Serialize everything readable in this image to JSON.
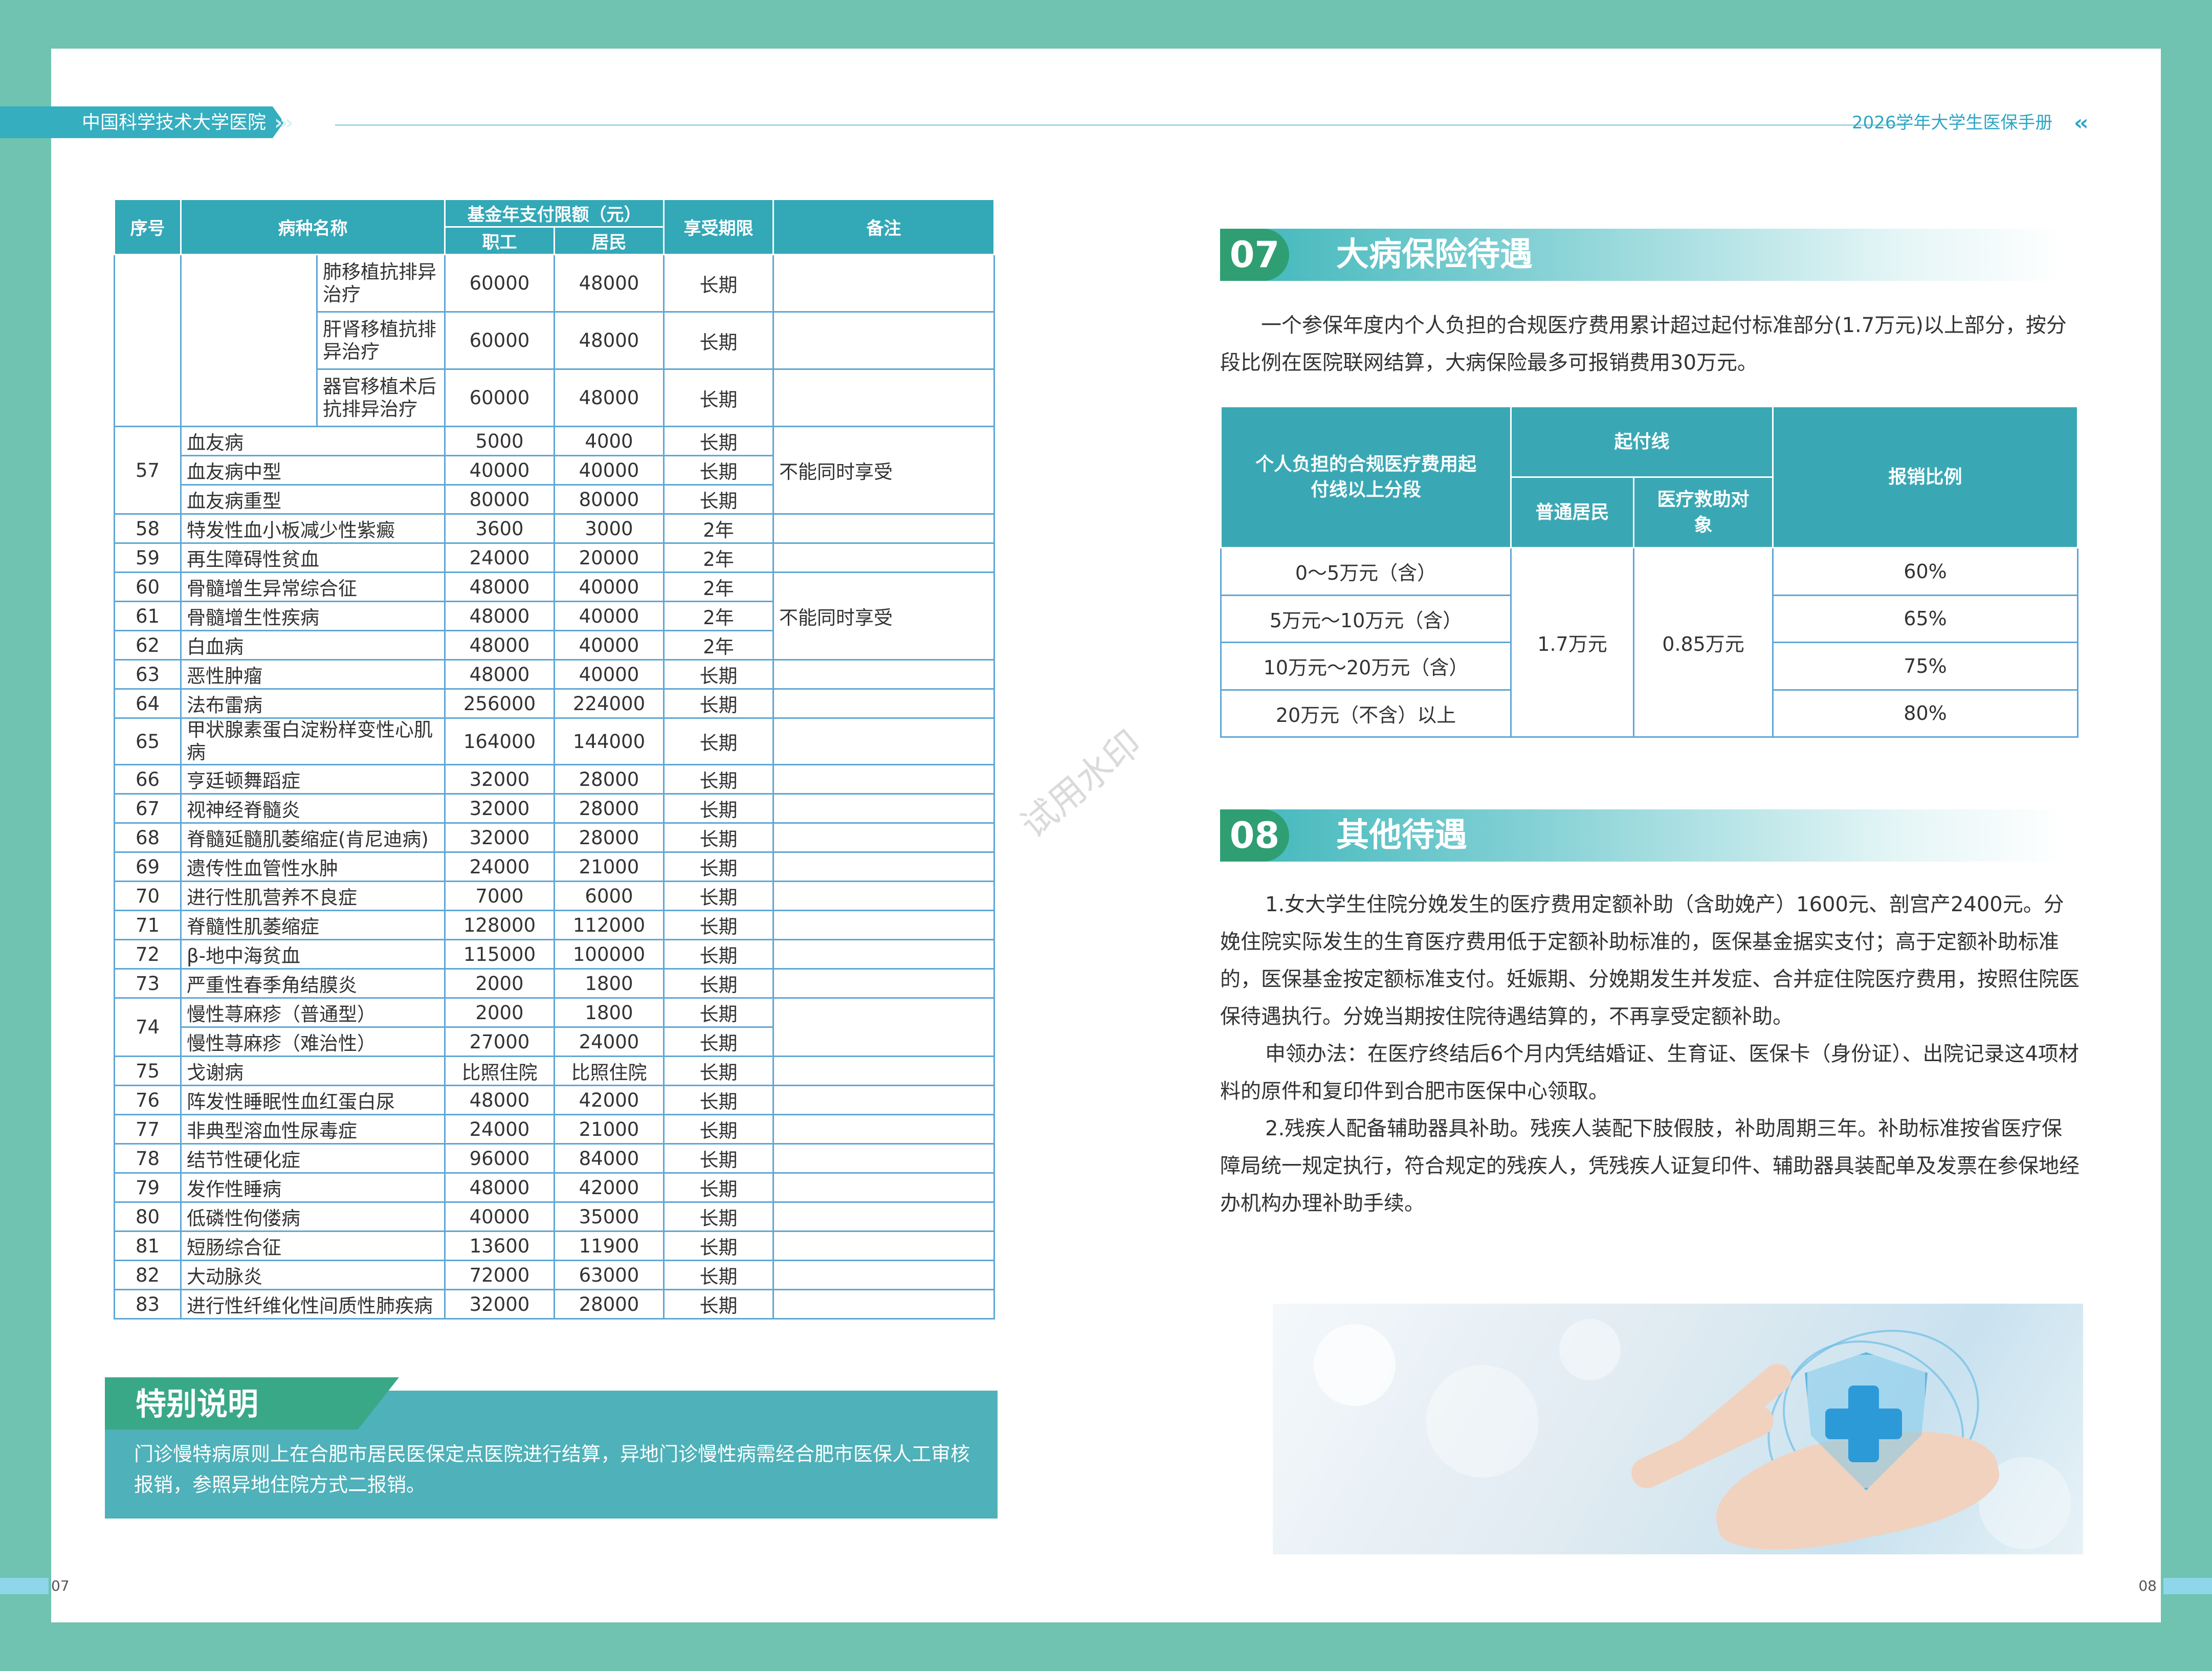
{
  "header": {
    "left_title": "中国科学技术大学医院",
    "left_chevrons": "›››",
    "right_title": "2026学年大学生医保手册",
    "right_chevrons": "‹‹"
  },
  "left_table": {
    "headers": {
      "seq": "序号",
      "name": "病种名称",
      "limit": "基金年支付限额（元）",
      "worker": "职工",
      "resident": "居民",
      "period": "享受期限",
      "remark": "备注"
    },
    "top_rows": [
      {
        "sub": "肺移植抗排异治疗",
        "worker": "60000",
        "resident": "48000",
        "period": "长期"
      },
      {
        "sub": "肝肾移植抗排异治疗",
        "worker": "60000",
        "resident": "48000",
        "period": "长期"
      },
      {
        "sub": "器官移植术后抗排异治疗",
        "worker": "60000",
        "resident": "48000",
        "period": "长期"
      }
    ],
    "g57": {
      "seq": "57",
      "remark": "不能同时享受",
      "rows": [
        {
          "name": "血友病",
          "worker": "5000",
          "resident": "4000",
          "period": "长期"
        },
        {
          "name": "血友病中型",
          "worker": "40000",
          "resident": "40000",
          "period": "长期"
        },
        {
          "name": "血友病重型",
          "worker": "80000",
          "resident": "80000",
          "period": "长期"
        }
      ]
    },
    "r58": {
      "seq": "58",
      "name": "特发性血小板减少性紫癜",
      "worker": "3600",
      "resident": "3000",
      "period": "2年"
    },
    "r59": {
      "seq": "59",
      "name": "再生障碍性贫血",
      "worker": "24000",
      "resident": "20000",
      "period": "2年"
    },
    "r60": {
      "seq": "60",
      "name": "骨髓增生异常综合征",
      "worker": "48000",
      "resident": "40000",
      "period": "2年"
    },
    "r61": {
      "seq": "61",
      "name": "骨髓增生性疾病",
      "worker": "48000",
      "resident": "40000",
      "period": "2年",
      "remark": "不能同时享受"
    },
    "r62": {
      "seq": "62",
      "name": "白血病",
      "worker": "48000",
      "resident": "40000",
      "period": "2年"
    },
    "r63": {
      "seq": "63",
      "name": "恶性肿瘤",
      "worker": "48000",
      "resident": "40000",
      "period": "长期"
    },
    "r64": {
      "seq": "64",
      "name": "法布雷病",
      "worker": "256000",
      "resident": "224000",
      "period": "长期"
    },
    "r65": {
      "seq": "65",
      "name": "甲状腺素蛋白淀粉样变性心肌病",
      "worker": "164000",
      "resident": "144000",
      "period": "长期"
    },
    "r66": {
      "seq": "66",
      "name": "亨廷顿舞蹈症",
      "worker": "32000",
      "resident": "28000",
      "period": "长期"
    },
    "r67": {
      "seq": "67",
      "name": "视神经脊髓炎",
      "worker": "32000",
      "resident": "28000",
      "period": "长期"
    },
    "r68": {
      "seq": "68",
      "name": "脊髓延髓肌萎缩症(肯尼迪病)",
      "worker": "32000",
      "resident": "28000",
      "period": "长期"
    },
    "r69": {
      "seq": "69",
      "name": "遗传性血管性水肿",
      "worker": "24000",
      "resident": "21000",
      "period": "长期"
    },
    "r70": {
      "seq": "70",
      "name": "进行性肌营养不良症",
      "worker": "7000",
      "resident": "6000",
      "period": "长期"
    },
    "r71": {
      "seq": "71",
      "name": "脊髓性肌萎缩症",
      "worker": "128000",
      "resident": "112000",
      "period": "长期"
    },
    "r72": {
      "seq": "72",
      "name": "β-地中海贫血",
      "worker": "115000",
      "resident": "100000",
      "period": "长期"
    },
    "r73": {
      "seq": "73",
      "name": "严重性春季角结膜炎",
      "worker": "2000",
      "resident": "1800",
      "period": "长期"
    },
    "g74": {
      "seq": "74",
      "rows": [
        {
          "name": "慢性荨麻疹（普通型）",
          "worker": "2000",
          "resident": "1800",
          "period": "长期"
        },
        {
          "name": "慢性荨麻疹（难治性）",
          "worker": "27000",
          "resident": "24000",
          "period": "长期"
        }
      ]
    },
    "r75": {
      "seq": "75",
      "name": "戈谢病",
      "worker": "比照住院",
      "resident": "比照住院",
      "period": "长期"
    },
    "r76": {
      "seq": "76",
      "name": "阵发性睡眠性血红蛋白尿",
      "worker": "48000",
      "resident": "42000",
      "period": "长期"
    },
    "r77": {
      "seq": "77",
      "name": "非典型溶血性尿毒症",
      "worker": "24000",
      "resident": "21000",
      "period": "长期"
    },
    "r78": {
      "seq": "78",
      "name": "结节性硬化症",
      "worker": "96000",
      "resident": "84000",
      "period": "长期"
    },
    "r79": {
      "seq": "79",
      "name": "发作性睡病",
      "worker": "48000",
      "resident": "42000",
      "period": "长期"
    },
    "r80": {
      "seq": "80",
      "name": "低磷性佝偻病",
      "worker": "40000",
      "resident": "35000",
      "period": "长期"
    },
    "r81": {
      "seq": "81",
      "name": "短肠综合征",
      "worker": "13600",
      "resident": "11900",
      "period": "长期"
    },
    "r82": {
      "seq": "82",
      "name": "大动脉炎",
      "worker": "72000",
      "resident": "63000",
      "period": "长期"
    },
    "r83": {
      "seq": "83",
      "name": "进行性纤维化性间质性肺疾病",
      "worker": "32000",
      "resident": "28000",
      "period": "长期"
    }
  },
  "special_note": {
    "title": "特别说明",
    "text": "门诊慢特病原则上在合肥市居民医保定点医院进行结算，异地门诊慢性病需经合肥市医保人工审核报销，参照异地住院方式二报销。"
  },
  "section07": {
    "num": "07",
    "title": "大病保险待遇",
    "intro": "一个参保年度内个人负担的合规医疗费用累计超过起付标准部分(1.7万元)以上部分，按分段比例在医院联网结算，大病保险最多可报销费用30万元。",
    "table": {
      "h_segment": "个人负担的合规医疗费用起付线以上分段",
      "h_deductible": "起付线",
      "h_resident": "普通居民",
      "h_assist": "医疗救助对象",
      "h_ratio": "报销比例",
      "resident_value": "1.7万元",
      "assist_value": "0.85万元",
      "rows": [
        {
          "segment": "0～5万元（含）",
          "ratio": "60%"
        },
        {
          "segment": "5万元～10万元（含）",
          "ratio": "65%"
        },
        {
          "segment": "10万元～20万元（含）",
          "ratio": "75%"
        },
        {
          "segment": "20万元（不含）以上",
          "ratio": "80%"
        }
      ]
    }
  },
  "section08": {
    "num": "08",
    "title": "其他待遇",
    "p1": "1.女大学生住院分娩发生的医疗费用定额补助（含助娩产）1600元、剖宫产2400元。分娩住院实际发生的生育医疗费用低于定额补助标准的，医保基金据实支付；高于定额补助标准的，医保基金按定额标准支付。妊娠期、分娩期发生并发症、合并症住院医疗费用，按照住院医保待遇执行。分娩当期按住院待遇结算的，不再享受定额补助。",
    "p2": "申领办法：在医疗终结后6个月内凭结婚证、生育证、医保卡（身份证）、出院记录这4项材料的原件和复印件到合肥市医保中心领取。",
    "p3": "2.残疾人配备辅助器具补助。残疾人装配下肢假肢，补助周期三年。补助标准按省医疗保障局统一规定执行，符合规定的残疾人，凭残疾人证复印件、辅助器具装配单及发票在参保地经办机构办理补助手续。"
  },
  "footer": {
    "page_left": "07",
    "page_right": "08"
  },
  "watermark": "试用水印"
}
